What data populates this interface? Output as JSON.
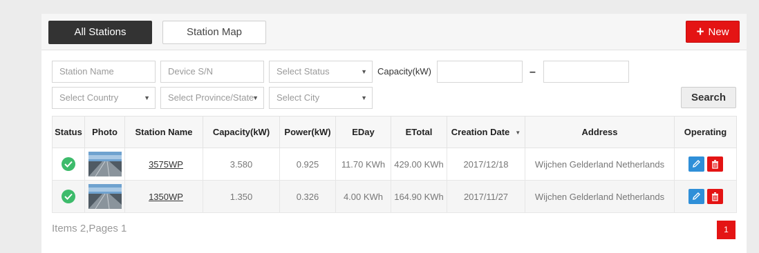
{
  "tabs": {
    "all_stations": "All Stations",
    "station_map": "Station Map"
  },
  "new_button": {
    "label": "New"
  },
  "filters": {
    "station_name_placeholder": "Station Name",
    "device_sn_placeholder": "Device S/N",
    "status_placeholder": "Select Status",
    "capacity_label": "Capacity(kW)",
    "capacity_separator": "–",
    "country_placeholder": "Select Country",
    "province_placeholder": "Select Province/State",
    "city_placeholder": "Select City",
    "search_label": "Search"
  },
  "table": {
    "headers": [
      "Status",
      "Photo",
      "Station Name",
      "Capacity(kW)",
      "Power(kW)",
      "EDay",
      "ETotal",
      "Creation Date",
      "Address",
      "Operating"
    ],
    "rows": [
      {
        "name": "3575WP",
        "capacity": "3.580",
        "power": "0.925",
        "eday": "11.70 KWh",
        "etotal": "429.00 KWh",
        "created": "2017/12/18",
        "address": "Wijchen Gelderland Netherlands"
      },
      {
        "name": "1350WP",
        "capacity": "1.350",
        "power": "0.326",
        "eday": "4.00 KWh",
        "etotal": "164.90 KWh",
        "created": "2017/11/27",
        "address": "Wijchen Gelderland Netherlands"
      }
    ]
  },
  "pagination": {
    "summary": "Items 2,Pages 1",
    "current_page": "1"
  },
  "colors": {
    "accent": "#e41414",
    "dark": "#333333",
    "edit": "#2f8fd8",
    "status_ok": "#3dbb6b"
  }
}
